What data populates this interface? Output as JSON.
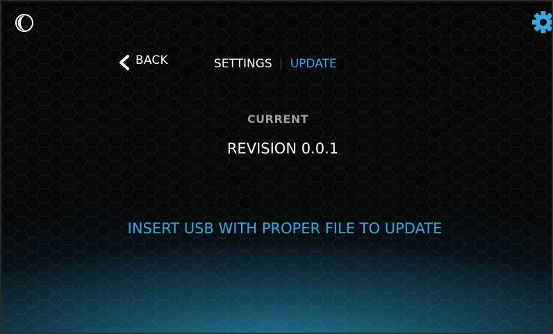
{
  "header": {
    "back_label": "BACK",
    "breadcrumb": {
      "settings": "SETTINGS",
      "current": "UPDATE"
    }
  },
  "main": {
    "current_label": "CURRENT",
    "revision": "REVISION 0.0.1",
    "instruction": "INSERT USB WITH PROPER FILE TO UPDATE"
  },
  "icons": {
    "theme": "moon-icon",
    "settings": "gear-icon",
    "back": "chevron-left-icon"
  },
  "colors": {
    "accent": "#35a9e0",
    "text": "#ffffff",
    "muted": "#9a9a9a",
    "background": "#060708",
    "glow": "#288caf"
  }
}
